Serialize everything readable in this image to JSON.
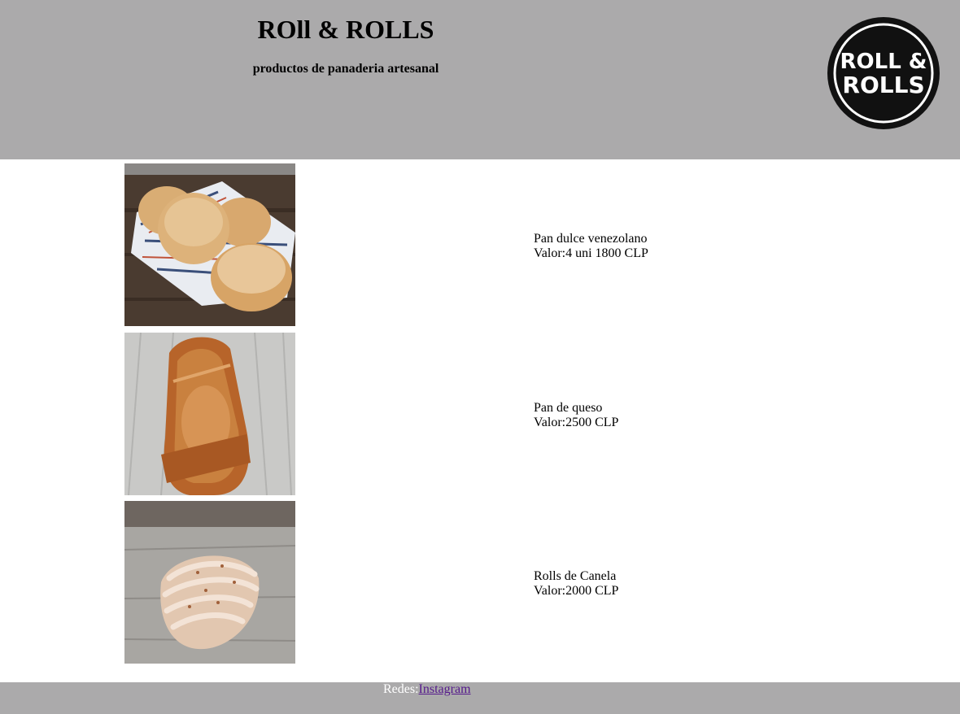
{
  "header": {
    "title": "ROll & ROLLS",
    "subtitle": "productos de panaderia artesanal",
    "logo": {
      "line1": "ROLL &",
      "line2": "ROLLS",
      "color": "#111111"
    },
    "background": "#abaaab"
  },
  "products": [
    {
      "name": "Pan dulce venezolano",
      "price": "Valor:4 uni 1800 CLP",
      "image": "bread-rolls-photo"
    },
    {
      "name": "Pan de queso",
      "price": "Valor:2500 CLP",
      "image": "cheese-bread-photo"
    },
    {
      "name": "Rolls de Canela",
      "price": "Valor:2000 CLP",
      "image": "cinnamon-roll-photo"
    }
  ],
  "footer": {
    "label": "Redes:",
    "link_text": "Instagram",
    "background": "#abaaab"
  }
}
